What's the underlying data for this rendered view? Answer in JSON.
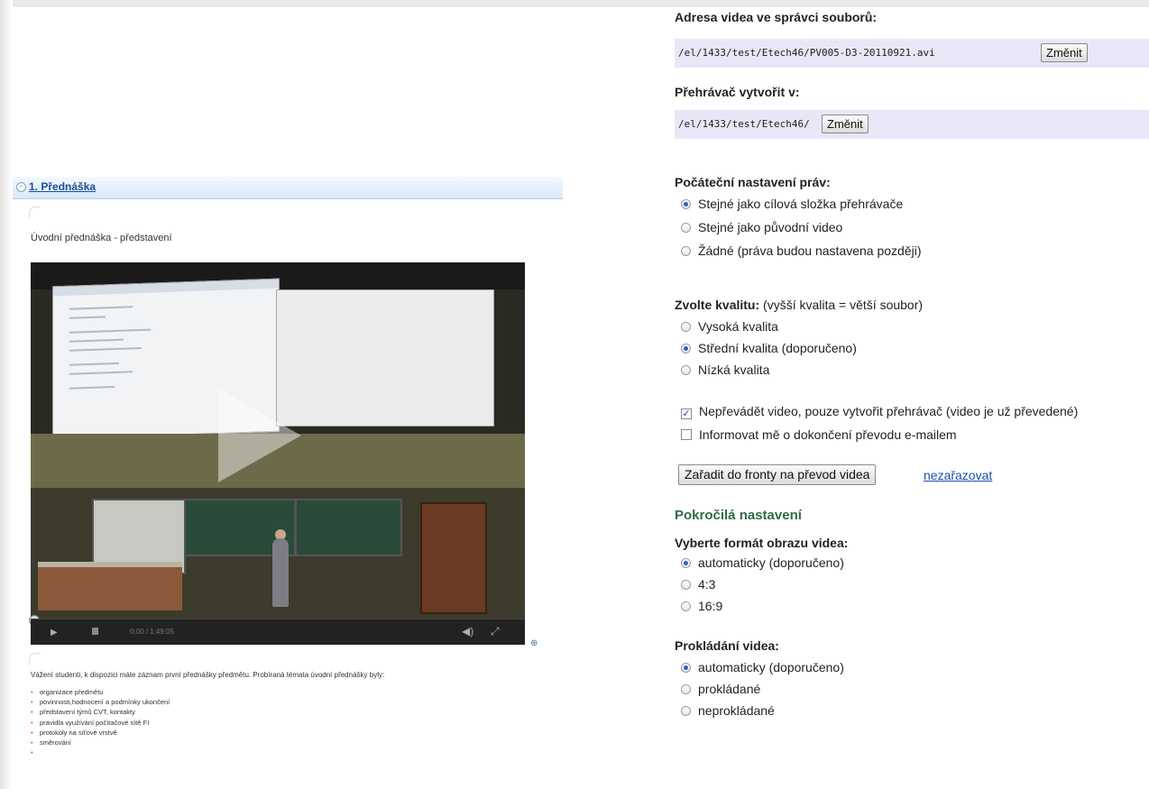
{
  "left": {
    "section_title": "1. Přednáška",
    "subtitle": "Úvodní přednáška - představení",
    "video_time": "0:00 / 1:49:05",
    "description": "Vážení studenti, k dispozici máte záznam první přednášky předmětu. Probíraná témata úvodní přednášky byly:",
    "topics": [
      "organizace předmětu",
      "povinnosti,hodnocení a podmínky ukončení",
      "představení týmů CVT, kontakty",
      "pravidla využívání počítačové sítě FI",
      "protokoly na síťové vrstvě",
      "směrování"
    ]
  },
  "right": {
    "video_address_label": "Adresa videa ve správci souborů:",
    "video_path": "/el/1433/test/Etech46/PV005-D3-20110921.avi",
    "change_button": "Změnit",
    "player_create_label": "Přehrávač vytvořit v:",
    "player_path": "/el/1433/test/Etech46/",
    "rights_label": "Počáteční nastavení práv:",
    "rights_options": [
      {
        "label": "Stejné jako cílová složka přehrávače",
        "selected": true
      },
      {
        "label": "Stejné jako původní video",
        "selected": false
      },
      {
        "label": "Žádné (práva budou nastavena později)",
        "selected": false
      }
    ],
    "quality_label": "Zvolte kvalitu:",
    "quality_hint": "(vyšší kvalita = větší soubor)",
    "quality_options": [
      {
        "label": "Vysoká kvalita",
        "selected": false
      },
      {
        "label": "Střední kvalita (doporučeno)",
        "selected": true
      },
      {
        "label": "Nízká kvalita",
        "selected": false
      }
    ],
    "check_no_convert": {
      "label": "Nepřevádět video, pouze vytvořit přehrávač (video je už převedené)",
      "checked": true
    },
    "check_notify": {
      "label": "Informovat mě o dokončení převodu e-mailem",
      "checked": false
    },
    "queue_button": "Zařadit do fronty na převod videa",
    "no_queue_link": "nezařazovat",
    "advanced_heading": "Pokročilá nastavení",
    "format_label": "Vyberte formát obrazu videa:",
    "format_options": [
      {
        "label": "automaticky (doporučeno)",
        "selected": true
      },
      {
        "label": "4:3",
        "selected": false
      },
      {
        "label": "16:9",
        "selected": false
      }
    ],
    "interlace_label": "Prokládání videa:",
    "interlace_options": [
      {
        "label": "automaticky (doporučeno)",
        "selected": true
      },
      {
        "label": "prokládané",
        "selected": false
      },
      {
        "label": "neprokládané",
        "selected": false
      }
    ]
  }
}
